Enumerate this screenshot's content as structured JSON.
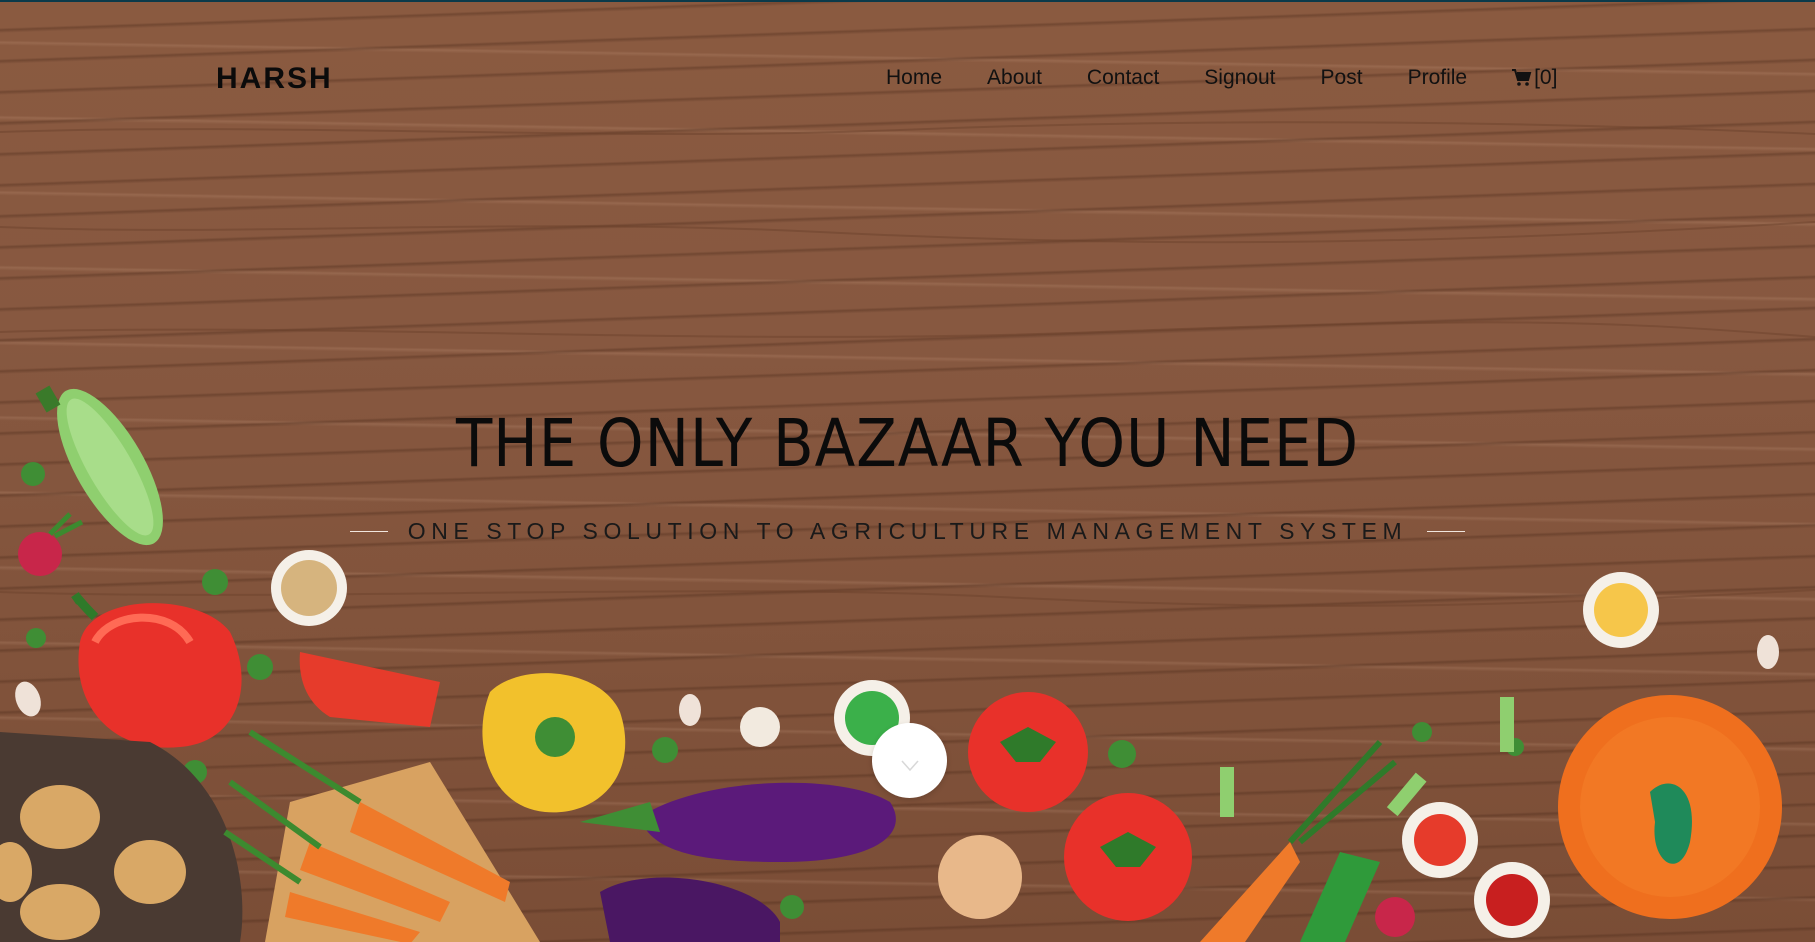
{
  "header": {
    "brand": "HARSH",
    "nav": [
      {
        "label": "Home"
      },
      {
        "label": "About"
      },
      {
        "label": "Contact"
      },
      {
        "label": "Signout"
      },
      {
        "label": "Post"
      },
      {
        "label": "Profile"
      }
    ],
    "cart": {
      "icon": "cart-icon",
      "count_label": "[0]"
    }
  },
  "hero": {
    "title": "THE ONLY BAZAAR YOU NEED",
    "subtitle": "ONE STOP SOLUTION TO AGRICULTURE MANAGEMENT SYSTEM",
    "scroll_icon": "chevron-down-icon"
  },
  "colors": {
    "wood": "#875840",
    "text": "#0b0b0b",
    "accent_button": "#ffffff"
  }
}
